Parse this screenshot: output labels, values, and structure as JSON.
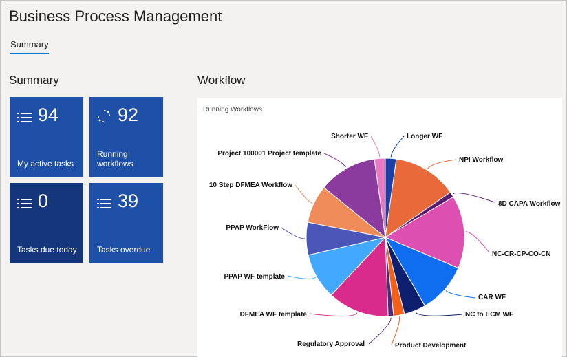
{
  "header": {
    "title": "Business Process Management"
  },
  "tabs": [
    {
      "label": "Summary",
      "selected": true
    }
  ],
  "summary": {
    "title": "Summary",
    "tiles": [
      {
        "count": "94",
        "label": "My active tasks",
        "icon": "list-icon"
      },
      {
        "count": "92",
        "label": "Running workflows",
        "icon": "refresh-icon"
      },
      {
        "count": "0",
        "label": "Tasks due today",
        "icon": "list-icon"
      },
      {
        "count": "39",
        "label": "Tasks overdue",
        "icon": "list-icon"
      }
    ]
  },
  "workflow": {
    "title": "Workflow",
    "card_title": "Running Workflows"
  },
  "colors": {
    "tile": "#1f50a8",
    "tile_dark": "#16367c",
    "tab_underline": "#0078d4"
  },
  "chart_data": {
    "type": "pie",
    "title": "Running Workflows",
    "slices": [
      {
        "label": "Longer WF",
        "value": 2.2,
        "color": "#1b3fa6"
      },
      {
        "label": "NPI Workflow",
        "value": 13.0,
        "color": "#e8693a"
      },
      {
        "label": "8D CAPA Workflow",
        "value": 1.1,
        "color": "#5a1a6e"
      },
      {
        "label": "NC-CR-CP-CO-CN",
        "value": 14.7,
        "color": "#dd4fb0"
      },
      {
        "label": "CAR WF",
        "value": 10.2,
        "color": "#0f6ef0"
      },
      {
        "label": "NC to ECM WF",
        "value": 4.4,
        "color": "#0d1f6e"
      },
      {
        "label": "Product Development",
        "value": 2.2,
        "color": "#f2601a"
      },
      {
        "label": "Regulatory Approval",
        "value": 1.1,
        "color": "#4e2a75"
      },
      {
        "label": "DFMEA WF template",
        "value": 12.4,
        "color": "#d82b8c"
      },
      {
        "label": "PPAP WF template",
        "value": 9.3,
        "color": "#43a8ff"
      },
      {
        "label": "PPAP WorkFlow",
        "value": 6.6,
        "color": "#4b57b8"
      },
      {
        "label": "10 Step DFMEA Workflow",
        "value": 7.7,
        "color": "#ef8c5a"
      },
      {
        "label": "Project 100001 Project template",
        "value": 11.8,
        "color": "#8b3a9e"
      },
      {
        "label": "Shorter WF",
        "value": 2.2,
        "color": "#e87ac3"
      }
    ]
  }
}
